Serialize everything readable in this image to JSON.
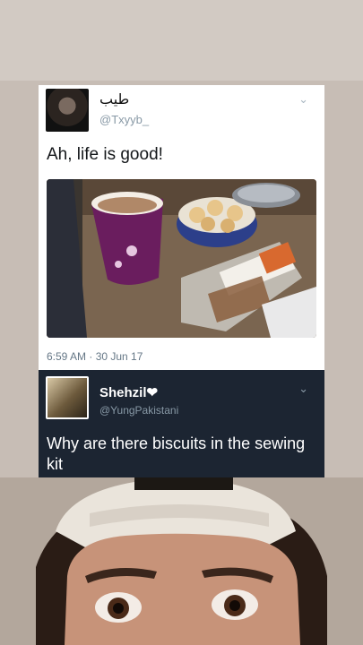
{
  "tweet": {
    "display_name": "طيب",
    "handle": "@Txyyb_",
    "text": "Ah, life is good!",
    "timestamp": "6:59 AM · 30 Jun 17",
    "menu_icon": "chevron-down-icon"
  },
  "reply": {
    "display_name": "Shehzil❤",
    "handle": "@YungPakistani",
    "text": "Why are there biscuits in the sewing kit",
    "menu_icon": "chevron-down-icon"
  },
  "colors": {
    "reply_bg": "#1c2532",
    "handle_gray": "#8899a6",
    "card_bg": "#ffffff"
  }
}
